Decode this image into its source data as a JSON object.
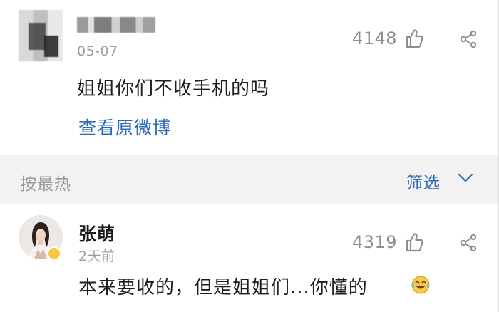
{
  "post": {
    "date": "05-07",
    "like_count": "4148",
    "text": "姐姐你们不收手机的吗",
    "view_original": "查看原微博"
  },
  "sort_bar": {
    "sort_label": "按最热",
    "filter_label": "筛选"
  },
  "comment": {
    "author": "张萌",
    "time": "2天前",
    "like_count": "4319",
    "text": "本来要收的，但是姐姐们...你懂的"
  },
  "colors": {
    "link_blue": "#2c6cb7",
    "muted_gray": "#9b9b9b",
    "sort_bar_bg": "#f2f2f2",
    "verified_badge": "#f6c945"
  },
  "icons": {
    "like": "thumbs-up-outline-icon",
    "share": "share-nodes-icon",
    "filter_chevron": "chevron-down-icon",
    "emoji": "laughing-tears-emoji-icon",
    "verified": "verified-badge-icon"
  }
}
